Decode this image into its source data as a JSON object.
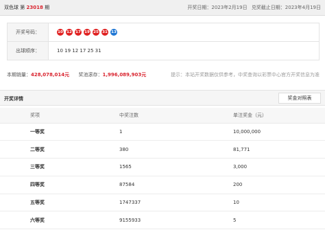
{
  "header": {
    "lottery_name": "双色球",
    "issue_prefix": "第",
    "issue_number": "23018",
    "issue_suffix": "期",
    "draw_date": "开奖日期：2023年2月19日",
    "deadline": "兑奖截止日期：2023年4月19日"
  },
  "info": {
    "numbers_label": "开奖号码：",
    "order_label": "出球顺序：",
    "red_balls": [
      "10",
      "12",
      "17",
      "19",
      "25",
      "31"
    ],
    "blue_ball": "13",
    "draw_order": "10 19 12 17 25 31"
  },
  "sales": {
    "sales_label": "本期销量：",
    "sales_value": "428,078,014元",
    "pool_label": "奖池滚存：",
    "pool_value": "1,996,089,903元",
    "hint": "提示：本站开奖数据仅供参考，中奖查询以彩票中心官方开奖信息为准"
  },
  "details": {
    "title": "开奖详情",
    "button_label": "奖金对照表",
    "columns": [
      "奖项",
      "中奖注数",
      "单注奖金（元）"
    ],
    "rows": [
      {
        "prize": "一等奖",
        "count": "1",
        "amount": "10,000,000"
      },
      {
        "prize": "二等奖",
        "count": "380",
        "amount": "81,771"
      },
      {
        "prize": "三等奖",
        "count": "1565",
        "amount": "3,000"
      },
      {
        "prize": "四等奖",
        "count": "87584",
        "amount": "200"
      },
      {
        "prize": "五等奖",
        "count": "1747337",
        "amount": "10"
      },
      {
        "prize": "六等奖",
        "count": "9155933",
        "amount": "5"
      }
    ]
  },
  "colors": {
    "red_ball": "#e02020",
    "blue_ball": "#1f77d4",
    "highlight": "#d9232e"
  }
}
